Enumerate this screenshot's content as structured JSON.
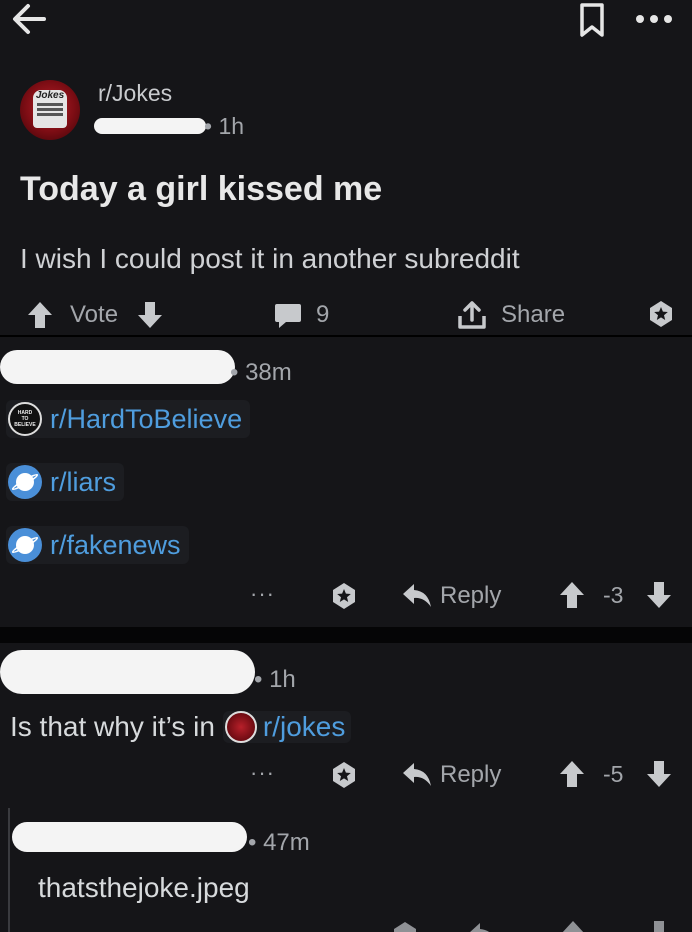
{
  "post": {
    "subreddit": "r/Jokes",
    "time": "• 1h",
    "title": "Today a girl kissed me",
    "body": "I wish I could post it in another subreddit",
    "vote_label": "Vote",
    "comment_count": "9",
    "share_label": "Share",
    "icon_logo_text": "Jokes"
  },
  "comments": [
    {
      "time": "• 38m",
      "subreddits": [
        {
          "name": "r/HardToBelieve",
          "icon_text": "HARD TO BELIEVE"
        },
        {
          "name": "r/liars"
        },
        {
          "name": "r/fakenews"
        }
      ],
      "more": "···",
      "reply_label": "Reply",
      "score": "-3"
    },
    {
      "time": "• 1h",
      "text_prefix": "Is that why it’s in",
      "sub_link": "r/jokes",
      "more": "···",
      "reply_label": "Reply",
      "score": "-5"
    },
    {
      "time": "• 47m",
      "text": "thatsthejoke.jpeg"
    }
  ],
  "colors": {
    "background": "#151518",
    "link": "#4f9dde",
    "text": "#d7dadc",
    "muted": "#a3a6ab"
  },
  "icons": [
    "back-arrow-icon",
    "bookmark-icon",
    "overflow-menu-icon",
    "upvote-icon",
    "downvote-icon",
    "comment-icon",
    "share-icon",
    "award-icon",
    "reply-icon"
  ]
}
